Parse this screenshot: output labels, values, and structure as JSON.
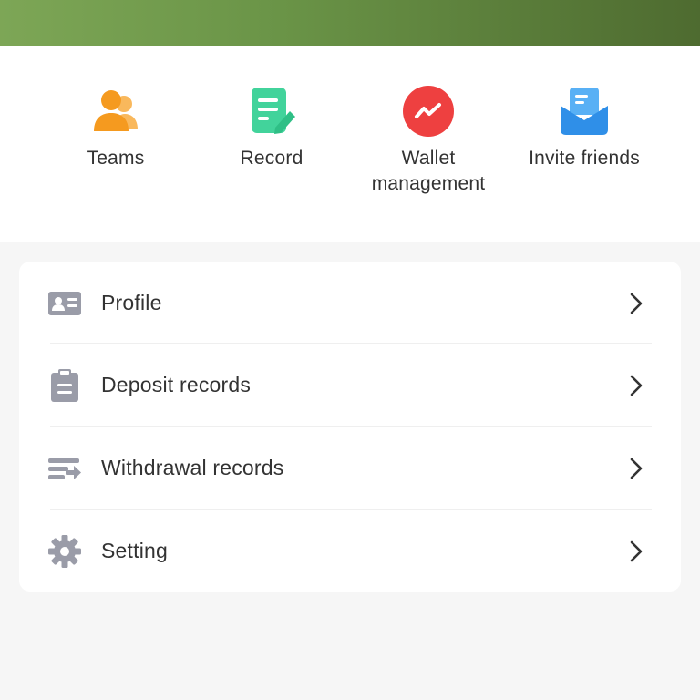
{
  "colors": {
    "banner_start": "#7da656",
    "banner_end": "#4e6b30",
    "teams_icon": "#f7a233",
    "record_icon": "#3ccf96",
    "wallet_icon": "#ef4444",
    "invite_icon": "#3d9ff0",
    "menu_icon": "#9a9ca8"
  },
  "quick_actions": [
    {
      "label": "Teams",
      "icon": "teams-icon"
    },
    {
      "label": "Record",
      "icon": "record-icon"
    },
    {
      "label": "Wallet management",
      "icon": "wallet-trend-icon"
    },
    {
      "label": "Invite friends",
      "icon": "envelope-icon"
    }
  ],
  "menu": [
    {
      "label": "Profile",
      "icon": "id-card-icon"
    },
    {
      "label": "Deposit records",
      "icon": "clipboard-icon"
    },
    {
      "label": "Withdrawal records",
      "icon": "transfer-icon"
    },
    {
      "label": "Setting",
      "icon": "gear-icon"
    }
  ]
}
